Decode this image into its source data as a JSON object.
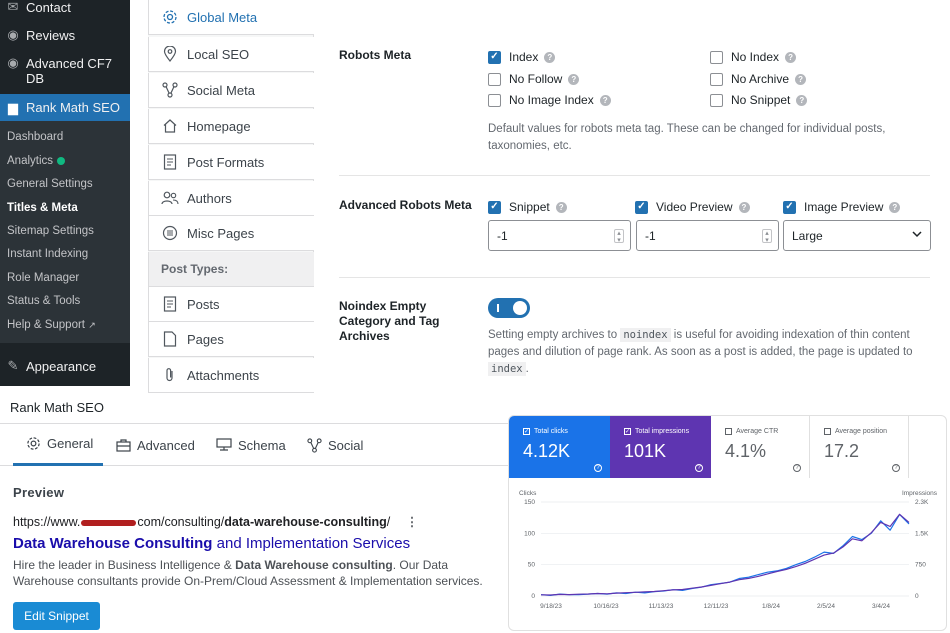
{
  "wp_menu": {
    "items": [
      {
        "label": "Contact",
        "icon": "mail-icon"
      },
      {
        "label": "Reviews",
        "icon": "eye-icon"
      },
      {
        "label": "Advanced CF7 DB",
        "icon": "eye-icon"
      },
      {
        "label": "Rank Math SEO",
        "icon": "chart-bars-icon"
      },
      {
        "label": "Appearance",
        "icon": "brush-icon"
      }
    ],
    "submenu": [
      "Dashboard",
      "Analytics",
      "General Settings",
      "Titles & Meta",
      "Sitemap Settings",
      "Instant Indexing",
      "Role Manager",
      "Status & Tools",
      "Help & Support"
    ],
    "current": "Titles & Meta",
    "analytics_dot_color": "#10b981"
  },
  "settings_nav": {
    "items": [
      "Global Meta",
      "Local SEO",
      "Social Meta",
      "Homepage",
      "Post Formats",
      "Authors",
      "Misc Pages"
    ],
    "section_header": "Post Types:",
    "post_types": [
      "Posts",
      "Pages",
      "Attachments"
    ],
    "active": "Global Meta"
  },
  "robots_meta": {
    "label": "Robots Meta",
    "options": [
      {
        "label": "Index",
        "checked": true
      },
      {
        "label": "No Index",
        "checked": false
      },
      {
        "label": "No Follow",
        "checked": false
      },
      {
        "label": "No Archive",
        "checked": false
      },
      {
        "label": "No Image Index",
        "checked": false
      },
      {
        "label": "No Snippet",
        "checked": false
      }
    ],
    "description": "Default values for robots meta tag. These can be changed for individual posts, taxonomies, etc."
  },
  "advanced_robots": {
    "label": "Advanced Robots Meta",
    "snippet": {
      "label": "Snippet",
      "checked": true,
      "value": "-1"
    },
    "video_preview": {
      "label": "Video Preview",
      "checked": true,
      "value": "-1"
    },
    "image_preview": {
      "label": "Image Preview",
      "checked": true,
      "value": "Large"
    }
  },
  "noindex_empty": {
    "label_lines": [
      "Noindex Empty",
      "Category and Tag",
      "Archives"
    ],
    "enabled": true,
    "desc_before": "Setting empty archives to",
    "code1": "noindex",
    "desc_middle": "is useful for avoiding indexation of thin content pages and dilution of page rank. As soon as a post is added, the page is updated to",
    "code2": "index",
    "desc_end": "."
  },
  "editor": {
    "title": "Rank Math SEO",
    "tabs": [
      "General",
      "Advanced",
      "Schema",
      "Social"
    ],
    "active_tab": "General",
    "preview_label": "Preview",
    "url_prefix": "https://www.",
    "url_mid": "com/consulting/",
    "url_slug": "data-warehouse-consulting",
    "url_end": "/",
    "serp_title_bold": "Data Warehouse Consulting",
    "serp_title_rest": " and Implementation Services",
    "desc_1": "Hire the leader in Business Intelligence & ",
    "desc_bold": "Data Warehouse consulting",
    "desc_2": ". Our Data Warehouse consultants provide On-Prem/Cloud Assessment & Implementation services.",
    "edit_button": "Edit Snippet"
  },
  "gsc": {
    "metrics": [
      {
        "label": "Total clicks",
        "value": "4.12K",
        "selected": true,
        "bg": "#1a73e8"
      },
      {
        "label": "Total impressions",
        "value": "101K",
        "selected": true,
        "bg": "#5e35b1"
      },
      {
        "label": "Average CTR",
        "value": "4.1%",
        "selected": false,
        "bg": "#ffffff"
      },
      {
        "label": "Average position",
        "value": "17.2",
        "selected": false,
        "bg": "#ffffff"
      }
    ]
  },
  "chart_data": {
    "type": "line",
    "x_ticks": [
      "9/18/23",
      "10/16/23",
      "11/13/23",
      "12/11/23",
      "1/8/24",
      "2/5/24",
      "3/4/24"
    ],
    "left_axis": {
      "label": "Clicks",
      "ticks": [
        "150",
        "100",
        "50",
        "0"
      ],
      "range": [
        0,
        150
      ]
    },
    "right_axis": {
      "label": "Impressions",
      "ticks": [
        "2.3K",
        "1.5K",
        "750",
        "0"
      ],
      "range": [
        0,
        2300
      ]
    },
    "series": [
      {
        "name": "Total clicks",
        "color": "#1a73e8",
        "axis": "left",
        "values": [
          2,
          1,
          3,
          2,
          2,
          3,
          4,
          3,
          5,
          4,
          6,
          5,
          7,
          8,
          10,
          9,
          12,
          14,
          18,
          20,
          22,
          28,
          30,
          34,
          38,
          40,
          44,
          50,
          55,
          62,
          70,
          68,
          80,
          95,
          90,
          100,
          120,
          105,
          130,
          115
        ]
      },
      {
        "name": "Total impressions",
        "color": "#5e35b1",
        "axis": "right",
        "values": [
          30,
          25,
          40,
          35,
          45,
          50,
          60,
          55,
          70,
          80,
          90,
          100,
          110,
          130,
          150,
          160,
          190,
          220,
          260,
          300,
          340,
          400,
          430,
          480,
          540,
          600,
          650,
          720,
          800,
          900,
          1000,
          1050,
          1200,
          1400,
          1350,
          1550,
          1800,
          1700,
          2000,
          1800
        ]
      }
    ]
  }
}
